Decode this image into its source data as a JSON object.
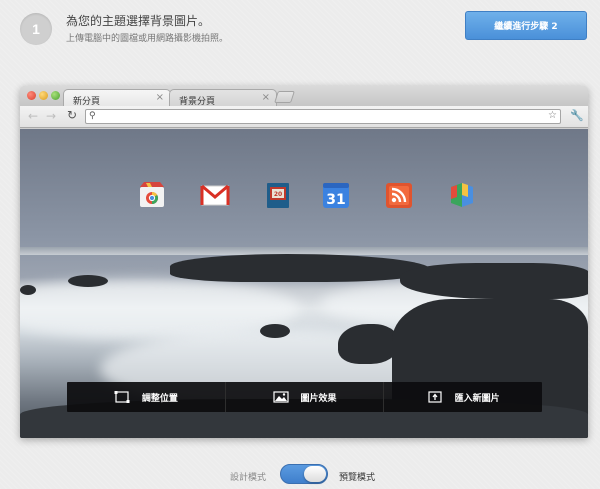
{
  "header": {
    "step_number": "1",
    "title": "為您的主題選擇背景圖片。",
    "subtitle": "上傳電腦中的圖檔或用網路攝影機拍照。",
    "continue_label": "繼續進行步驟 2"
  },
  "browser": {
    "tabs": [
      {
        "label": "新分頁"
      },
      {
        "label": "背景分頁"
      }
    ],
    "omnibox_value": ""
  },
  "apps": {
    "calendar_day": "31",
    "book_day": "20"
  },
  "bottom_bar": {
    "position_label": "調整位置",
    "effects_label": "圖片效果",
    "import_label": "匯入新圖片"
  },
  "mode_toggle": {
    "left_label": "設計模式",
    "right_label": "預覽模式",
    "selected": "預覽模式"
  },
  "colors": {
    "accent": "#4a90d9",
    "toolbar_bar": "#0c0c0e"
  }
}
